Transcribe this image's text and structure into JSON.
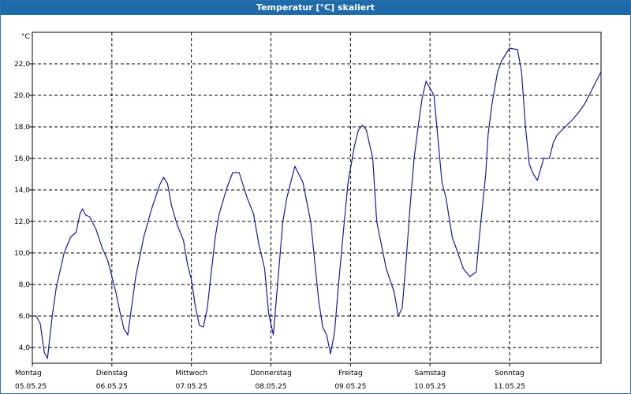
{
  "window": {
    "title": "Temperatur [°C] skaliert"
  },
  "chart_data": {
    "type": "line",
    "title": "Temperatur [°C] skaliert",
    "unit_label": "°C",
    "xlabel": "",
    "ylabel": "°C",
    "ylim": [
      3,
      24
    ],
    "xlim": [
      0,
      7.15
    ],
    "grid": true,
    "y_ticks": [
      "4,0",
      "6,0",
      "8,0",
      "10,0",
      "12,0",
      "14,0",
      "16,0",
      "18,0",
      "20,0",
      "22,0"
    ],
    "y_tick_values": [
      4,
      6,
      8,
      10,
      12,
      14,
      16,
      18,
      20,
      22
    ],
    "x_ticks": [
      {
        "day": "Montag",
        "date": "05.05.25"
      },
      {
        "day": "Dienstag",
        "date": "06.05.25"
      },
      {
        "day": "Mittwoch",
        "date": "07.05.25"
      },
      {
        "day": "Donnerstag",
        "date": "08.05.25"
      },
      {
        "day": "Freitag",
        "date": "09.05.25"
      },
      {
        "day": "Samstag",
        "date": "10.05.25"
      },
      {
        "day": "Sonntag",
        "date": "11.05.25"
      }
    ],
    "series": [
      {
        "color": "#1a1aa0",
        "x": [
          0.0,
          0.05,
          0.1,
          0.15,
          0.19,
          0.25,
          0.3,
          0.4,
          0.48,
          0.55,
          0.6,
          0.63,
          0.67,
          0.72,
          0.8,
          0.88,
          0.95,
          1.05,
          1.1,
          1.15,
          1.2,
          1.3,
          1.4,
          1.5,
          1.6,
          1.65,
          1.7,
          1.75,
          1.82,
          1.9,
          1.95,
          2.0,
          2.05,
          2.1,
          2.15,
          2.2,
          2.25,
          2.3,
          2.35,
          2.45,
          2.52,
          2.6,
          2.7,
          2.78,
          2.85,
          2.92,
          2.97,
          3.03,
          3.1,
          3.15,
          3.2,
          3.25,
          3.3,
          3.4,
          3.5,
          3.6,
          3.65,
          3.7,
          3.75,
          3.8,
          3.85,
          3.9,
          3.97,
          4.05,
          4.1,
          4.15,
          4.2,
          4.28,
          4.33,
          4.45,
          4.55,
          4.6,
          4.65,
          4.7,
          4.75,
          4.8,
          4.85,
          4.9,
          4.95,
          5.05,
          5.15,
          5.2,
          5.28,
          5.35,
          5.42,
          5.5,
          5.58,
          5.62,
          5.7,
          5.73,
          5.78,
          5.85,
          5.9,
          6.0,
          6.1,
          6.15,
          6.2,
          6.25,
          6.3,
          6.35,
          6.43,
          6.5,
          6.55,
          6.6,
          6.7,
          6.8,
          6.88,
          6.95,
          7.0,
          7.05,
          7.1,
          7.15
        ],
        "y": [
          6.0,
          6.0,
          5.5,
          3.7,
          3.3,
          6.0,
          7.8,
          10.0,
          11.0,
          11.3,
          12.5,
          12.8,
          12.4,
          12.3,
          11.5,
          10.3,
          9.5,
          7.5,
          6.3,
          5.2,
          4.8,
          8.5,
          11.0,
          12.8,
          14.3,
          14.8,
          14.4,
          13.0,
          11.8,
          10.8,
          9.3,
          8.3,
          6.6,
          5.4,
          5.3,
          6.5,
          8.8,
          11.0,
          12.5,
          14.2,
          15.1,
          15.1,
          13.5,
          12.5,
          10.5,
          9.0,
          6.2,
          4.8,
          9.0,
          12.0,
          13.5,
          14.5,
          15.5,
          14.5,
          12.0,
          7.0,
          5.3,
          4.8,
          3.6,
          5.0,
          8.0,
          10.8,
          14.5,
          16.8,
          17.8,
          18.1,
          17.8,
          16.0,
          12.0,
          9.0,
          7.5,
          6.0,
          6.5,
          9.5,
          13.0,
          16.0,
          18.0,
          19.8,
          20.9,
          20.0,
          14.5,
          13.5,
          11.0,
          10.0,
          9.0,
          8.5,
          8.8,
          11.0,
          15.0,
          17.5,
          19.5,
          21.5,
          22.2,
          23.0,
          22.9,
          21.5,
          18.0,
          15.6,
          15.0,
          14.6,
          16.0,
          16.0,
          17.0,
          17.5,
          18.0,
          18.5,
          19.0,
          19.5,
          20.0,
          20.5,
          21.0,
          21.5
        ]
      }
    ]
  }
}
